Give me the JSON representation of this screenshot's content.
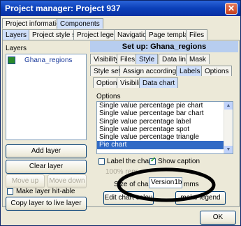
{
  "window": {
    "title": "Project manager: Project 937"
  },
  "top_tabs": [
    "Project information",
    "Components"
  ],
  "main_tabs": [
    "Layers",
    "Project style set",
    "Project legend",
    "Navigation",
    "Page template",
    "Files"
  ],
  "layers": {
    "heading": "Layers",
    "items": [
      "Ghana_regions"
    ]
  },
  "left_buttons": {
    "add": "Add layer",
    "clear": "Clear layer",
    "move_up": "Move up",
    "move_down": "Move down",
    "hit_able": "Make layer hit-able",
    "copy": "Copy layer to live layer"
  },
  "setup": {
    "title": "Set up: Ghana_regions"
  },
  "setup_tabs": [
    "Visibility",
    "Files",
    "Style",
    "Data link",
    "Mask"
  ],
  "style_tabs": [
    "Style set",
    "Assign according to...",
    "Labels",
    "Options"
  ],
  "label_tabs": [
    "Option",
    "Visibility",
    "Data chart"
  ],
  "options": {
    "heading": "Options",
    "items": [
      "Single value percentage pie chart",
      "Single value percentage bar chart",
      "Single value percentage label",
      "Single value percentage spot",
      "Single value percentage triangle",
      "Pie chart"
    ],
    "selected_index": 5
  },
  "checkboxes": {
    "label_chart": "Label the chart",
    "show_caption": "Show caption"
  },
  "size_row": {
    "faded_text": "100% repr",
    "label": "Size of chart",
    "value": "Version1b",
    "unit": "mms"
  },
  "buttons": {
    "edit_chart": "Edit chart colou",
    "make_legend": "make legend",
    "ok": "OK"
  },
  "colors": {
    "title_bar": "#0b3fb8",
    "selection": "#316ac5",
    "annotation": "#000000"
  }
}
